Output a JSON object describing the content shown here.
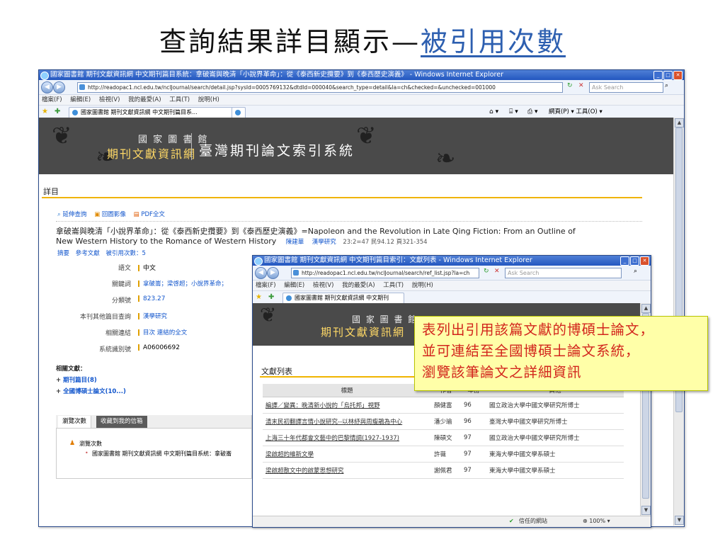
{
  "slide": {
    "title_prefix": "查詢結果詳目顯示—",
    "title_highlight": "被引用次數"
  },
  "main_window": {
    "title": "國家圖書館 期刊文獻資訊網 中文期刊篇目系統：拿破崙與晚清「小說界革命」：從《泰西新史攬要》到《泰西歷史演義》 - Windows Internet Explorer",
    "url": "http://readopac1.ncl.edu.tw/nclJournal/search/detail.jsp?sysId=0005769132&dtdId=000040&search_type=detail&la=ch&checked=&unchecked=001000",
    "search_placeholder": "Ask Search",
    "menu": [
      "檔案(F)",
      "編輯(E)",
      "檢視(V)",
      "我的最愛(A)",
      "工具(T)",
      "說明(H)"
    ],
    "tab_label": "國家圖書館 期刊文獻資訊網 中文期刊篇目系...",
    "cmd_bar": "網頁(P) ▾  工具(O) ▾",
    "banner": {
      "lib_name": "國 家 圖 書 館",
      "lib_sub": "期刊文獻資訊網",
      "system_title": "臺灣期刊論文索引系統"
    },
    "section_title": "詳目",
    "tools": [
      "延伸查詢",
      "回圖影像",
      "PDF全文"
    ],
    "article_title": "拿破崙與晚清「小說界革命」：從《泰西新史攬要》到《泰西歷史演義》=Napoleon and the Revolution in Late Qing Fiction: From an Outline of",
    "article_title2": "New Western History to the Romance of Western History",
    "author": "陳建華",
    "journal": "漢學研究",
    "issue": "23:2=47 民94.12  頁321-354",
    "links": [
      "摘要",
      "參考文獻",
      "被引用次數：5"
    ],
    "fields": [
      {
        "label": "語文",
        "value": "中文"
      },
      {
        "label": "關鍵詞",
        "value": "拿破崙；梁啓超；小說界革命；"
      },
      {
        "label": "分類號",
        "value": "823.27"
      },
      {
        "label": "本刊其他篇目查詢",
        "value": "漢學研究"
      },
      {
        "label": "相關連結",
        "value": "目次 連結的全文"
      },
      {
        "label": "系統識別號",
        "value": "A06006692"
      }
    ],
    "related_title": "相關文獻：",
    "related": [
      "期刊篇目(8)",
      "全國博碩士論文(10...)"
    ],
    "bottom_tabs": [
      "瀏覽次數",
      "收藏到我的信箱"
    ],
    "views_label": "瀏覽次數",
    "views_item": "國家圖書館 期刊文獻資訊網 中文期刊篇目系統：拿破崙"
  },
  "popup_window": {
    "title": "國家圖書館 期刊文獻資訊網 中文期刊篇目索引：文獻列表 - Windows Internet Explorer",
    "url": "http://readopac1.ncl.edu.tw/nclJournal/search/ref_list.jsp?la=ch",
    "search_placeholder": "Ask Search",
    "menu": [
      "檔案(F)",
      "編輯(E)",
      "檢視(V)",
      "我的最愛(A)",
      "工具(T)",
      "說明(H)"
    ],
    "tab_label": "國家圖書館 期刊文獻資訊網 中文期刊",
    "banner": {
      "lib_name": "國 家 圖 書 館",
      "lib_sub": "期刊文獻資訊網"
    },
    "section_title": "文獻列表",
    "columns": [
      "標題",
      "作者",
      "年份",
      "其他"
    ],
    "rows": [
      {
        "title": "編譯／變異：晚清新小說的「烏托邦」視野",
        "author": "顏健富",
        "year": "96",
        "other": "國立政治大學中國文學研究所博士"
      },
      {
        "title": "清末民初翻譯言情小說研究--以林紓與周瘦鵑為中心",
        "author": "潘少瑜",
        "year": "96",
        "other": "臺灣大學中國文學研究所博士"
      },
      {
        "title": "上海三十年代都會文藝中的巴黎情調(1927-1937)",
        "author": "陳碩文",
        "year": "97",
        "other": "國立政治大學中國文學研究所博士"
      },
      {
        "title": "梁啟超的維新文學",
        "author": "許薇",
        "year": "97",
        "other": "東海大學中國文學系碩士"
      },
      {
        "title": "梁啟超散文中的啟蒙思想研究",
        "author": "謝佩君",
        "year": "97",
        "other": "東海大學中國文學系碩士"
      }
    ],
    "status_zone": "信任的網站",
    "zoom": "100%"
  },
  "callout": {
    "line1": "表列出引用該篇文獻的博碩士論文，",
    "line2": "並可連結至全國博碩士論文系統，",
    "line3": "瀏覽該筆論文之詳細資訊"
  }
}
